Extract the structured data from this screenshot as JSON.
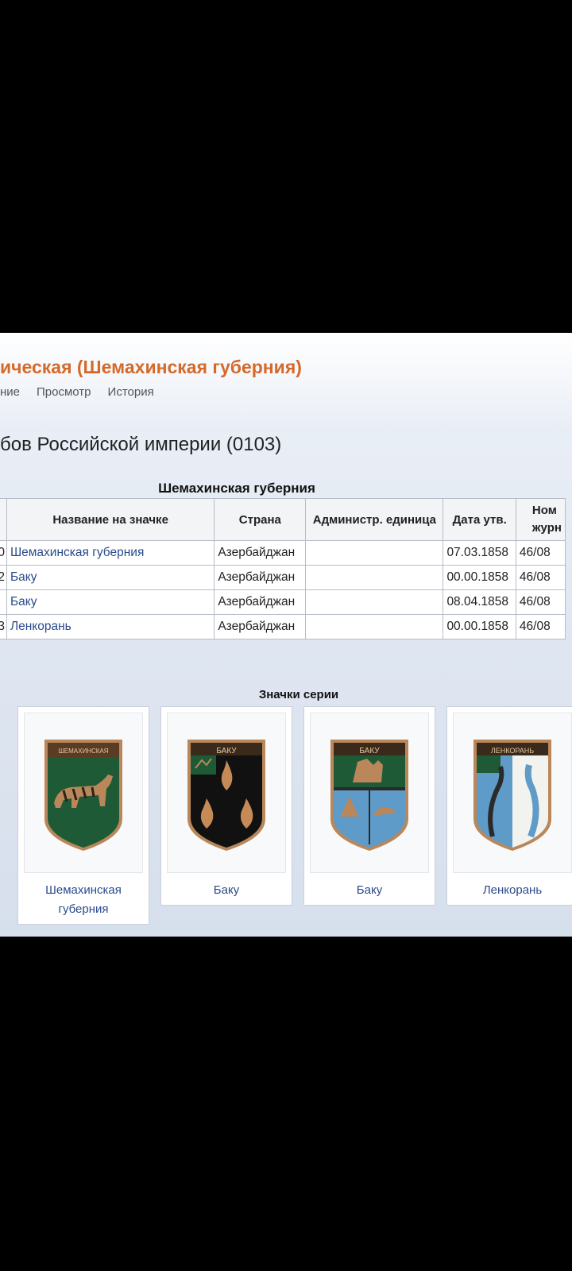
{
  "header": {
    "title": "ическая (Шемахинская губерния)",
    "tabs": [
      "ние",
      "Просмотр",
      "История"
    ]
  },
  "subtitle": "бов Российской империи (0103)",
  "table": {
    "caption": "Шемахинская губерния",
    "headers": [
      "",
      "Название на значке",
      "Страна",
      "Администр. единица",
      "Дата утв.",
      "Ном жург"
    ],
    "header_jour_line1": "Ном",
    "header_jour_line2": "журн",
    "rows": [
      {
        "num": "0",
        "name": "Шемахинская губерния",
        "country": "Азербайджан",
        "admin": "",
        "date": "07.03.1858",
        "journal": "46/08"
      },
      {
        "num": "2",
        "name": "Баку",
        "country": "Азербайджан",
        "admin": "",
        "date": "00.00.1858",
        "journal": "46/08"
      },
      {
        "num": "",
        "name": "Баку",
        "country": "Азербайджан",
        "admin": "",
        "date": "08.04.1858",
        "journal": "46/08"
      },
      {
        "num": "3",
        "name": "Ленкорань",
        "country": "Азербайджан",
        "admin": "",
        "date": "00.00.1858",
        "journal": "46/08"
      }
    ]
  },
  "gallery": {
    "title": "Значки серии",
    "items": [
      {
        "caption": "Шемахинская губерния",
        "banner": "ШЕМАХИНСКАЯ",
        "icon": "shemakha-badge-icon"
      },
      {
        "caption": "Баку",
        "banner": "БАКУ",
        "icon": "baku-black-badge-icon"
      },
      {
        "caption": "Баку",
        "banner": "БАКУ",
        "icon": "baku-blue-badge-icon"
      },
      {
        "caption": "Ленкорань",
        "banner": "ЛЕНКОРАНЬ",
        "icon": "lenkoran-badge-icon"
      }
    ]
  },
  "colors": {
    "title_orange": "#d46a2a",
    "link_blue": "#2a4b8d",
    "badge_green": "#1f5a36",
    "badge_black": "#111111",
    "badge_blue": "#5f9bc8",
    "badge_gold": "#b9875a"
  }
}
